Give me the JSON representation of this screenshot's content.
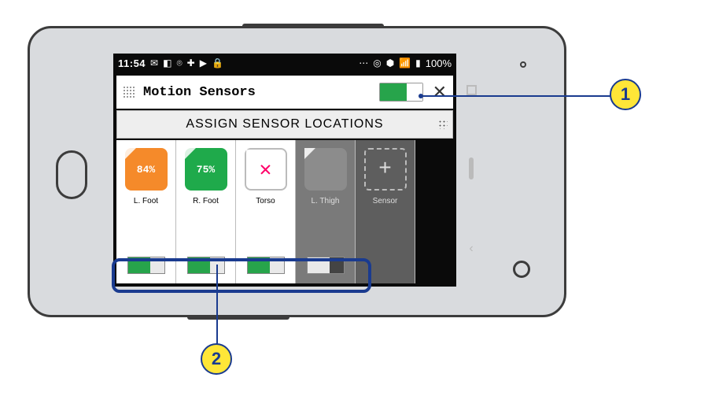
{
  "status": {
    "clock": "11:54",
    "left_icons": [
      "✉",
      "◧",
      "⌾",
      "✚",
      "▶",
      "🔒"
    ],
    "right_icons": [
      "⋯",
      "◎",
      "⬢",
      "📶",
      "▮"
    ],
    "battery_text": "100%"
  },
  "header": {
    "title": "Motion Sensors",
    "toggle_on": true,
    "close_glyph": "✕"
  },
  "assign_row": {
    "label": "ASSIGN SENSOR LOCATIONS"
  },
  "sensors": [
    {
      "label": "L. Foot",
      "battery": "84%",
      "tile_color": "orange",
      "toggle": "on",
      "enabled": true
    },
    {
      "label": "R. Foot",
      "battery": "75%",
      "tile_color": "green",
      "toggle": "on",
      "enabled": true
    },
    {
      "label": "Torso",
      "battery": "",
      "tile_color": "white",
      "toggle": "on",
      "enabled": true
    },
    {
      "label": "L. Thigh",
      "battery": "",
      "tile_color": "grey",
      "toggle": "off",
      "enabled": false
    },
    {
      "label": "Sensor",
      "battery": "",
      "tile_color": "dashed",
      "toggle": "",
      "enabled": false
    }
  ],
  "callouts": {
    "one": "1",
    "two": "2"
  },
  "nav": {
    "back_glyph": "‹"
  }
}
